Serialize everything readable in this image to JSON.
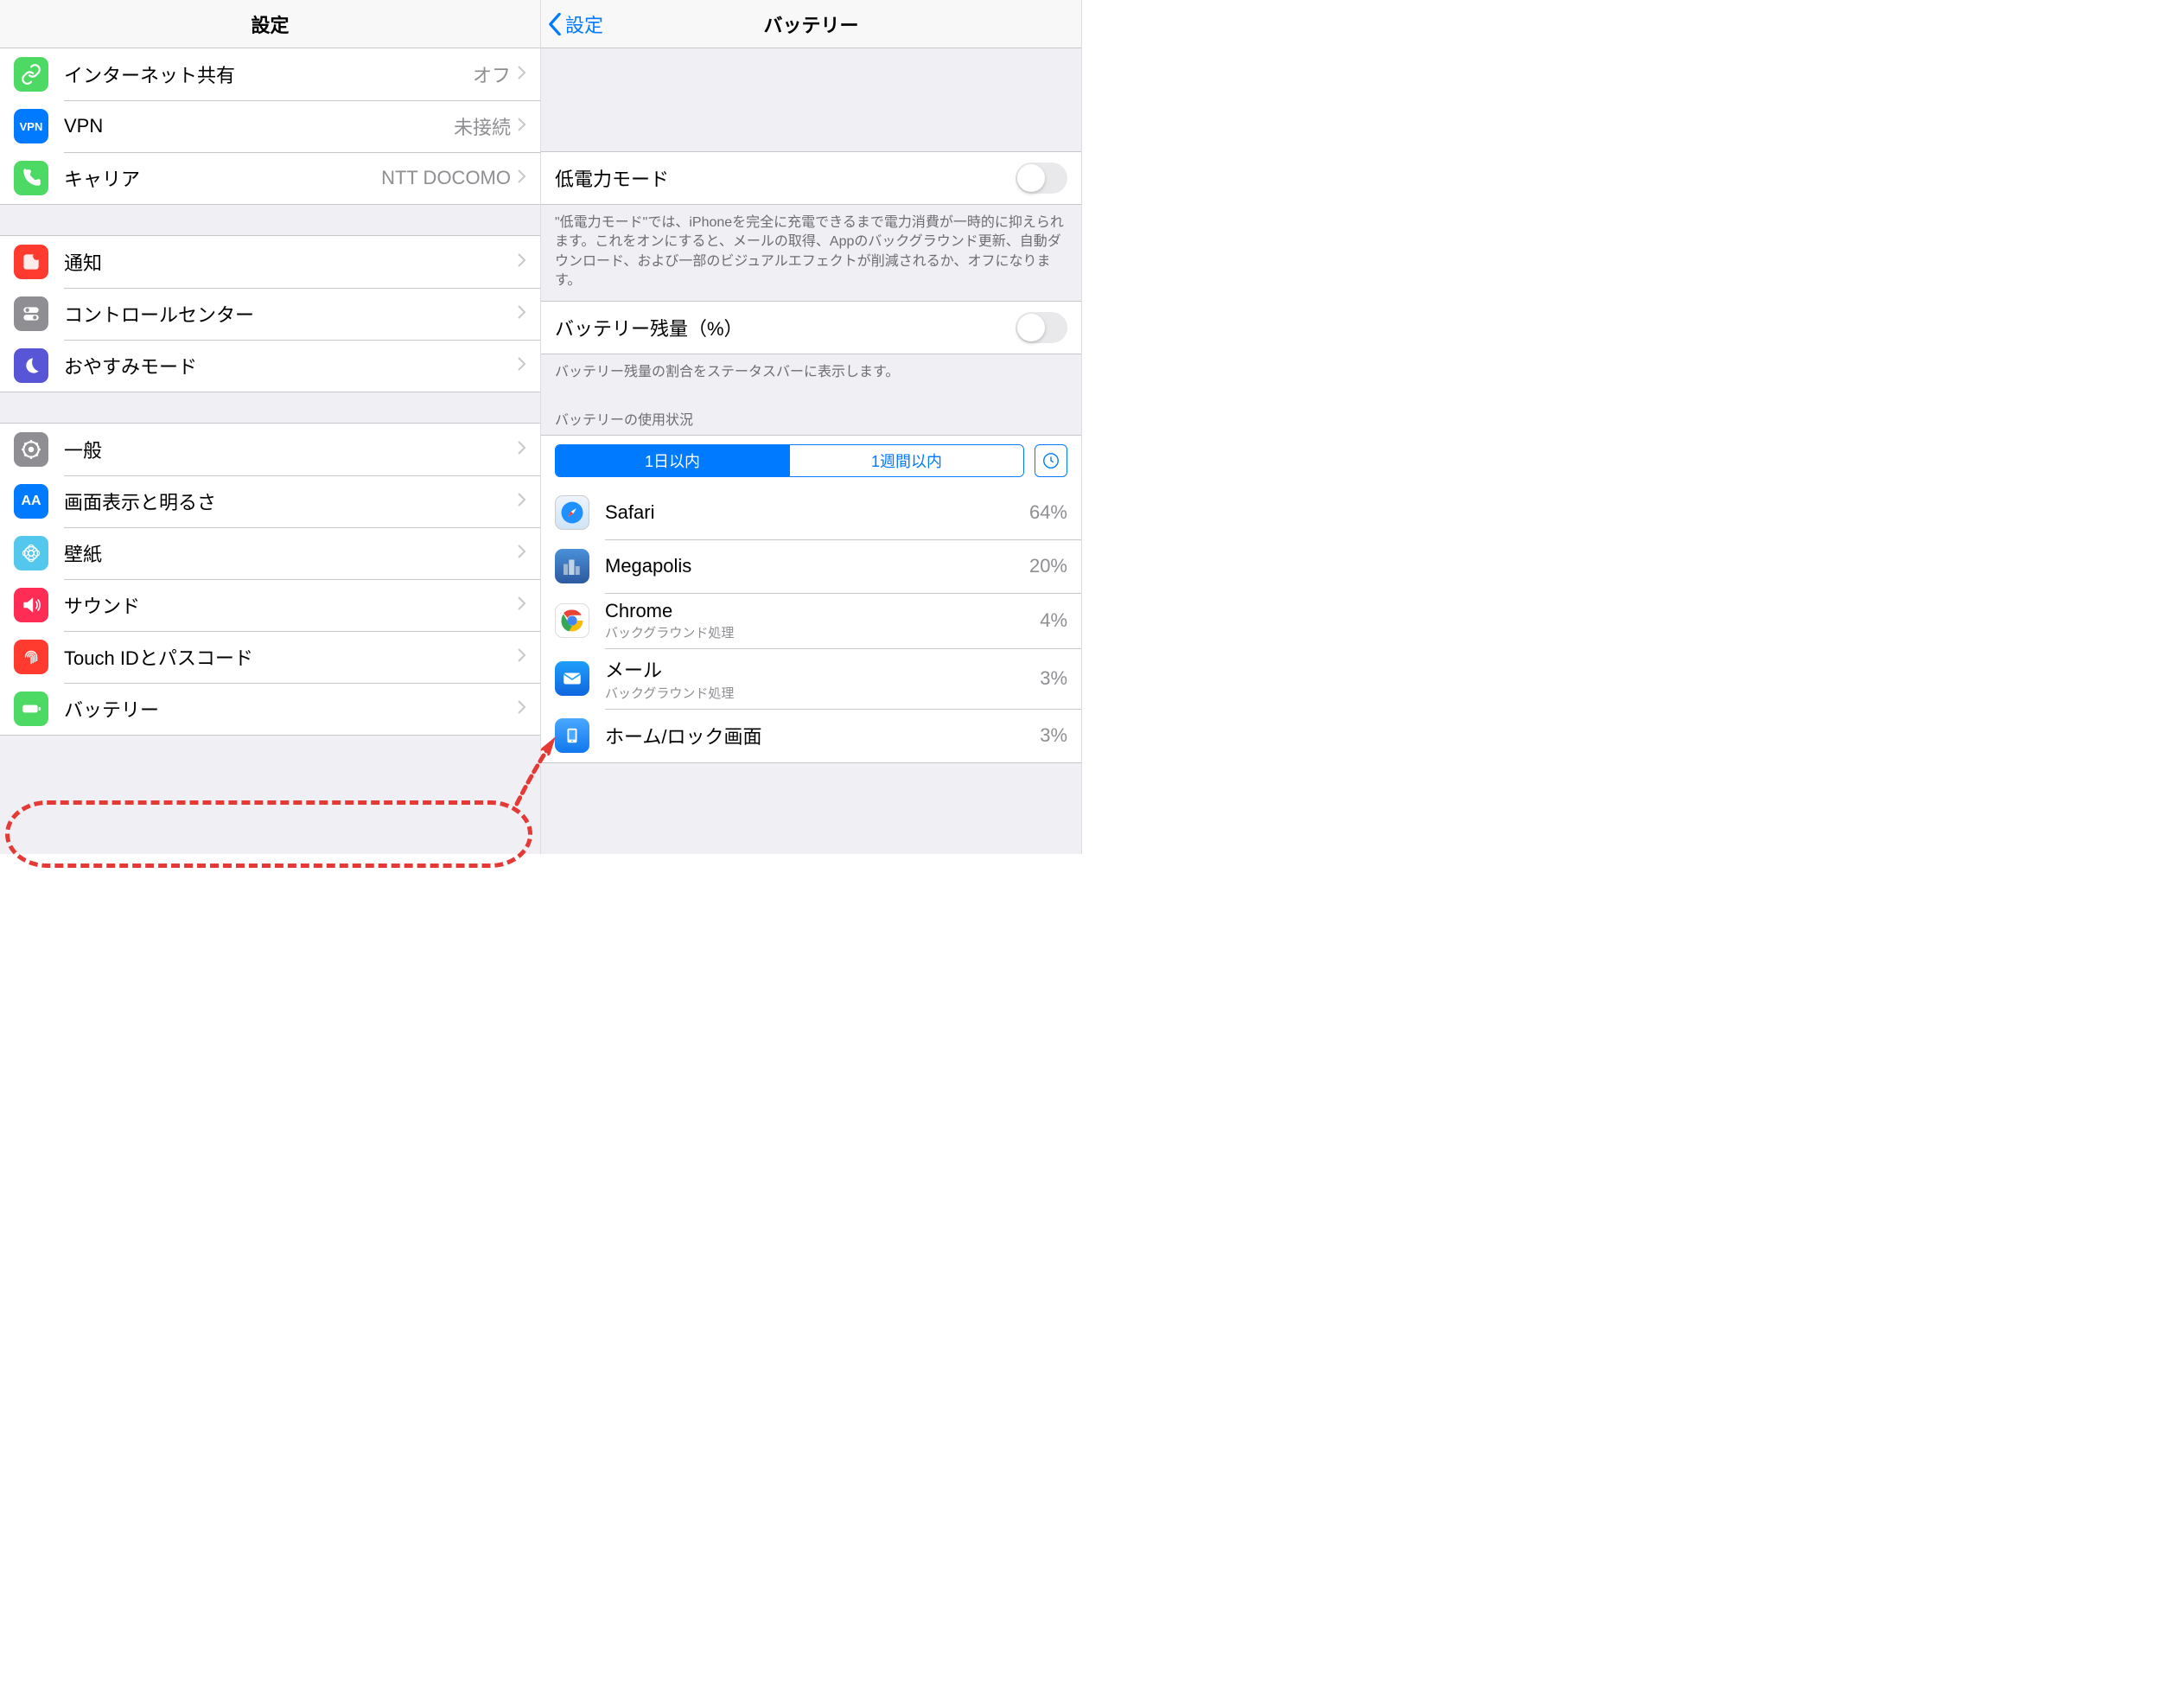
{
  "left": {
    "title": "設定",
    "groups": [
      {
        "rows": [
          {
            "icon": "link-icon",
            "bg": "#4cd964",
            "label": "インターネット共有",
            "value": "オフ"
          },
          {
            "icon": "vpn-icon",
            "bg": "#007aff",
            "label": "VPN",
            "value": "未接続",
            "iconText": "VPN"
          },
          {
            "icon": "phone-icon",
            "bg": "#4cd964",
            "label": "キャリア",
            "value": "NTT DOCOMO"
          }
        ]
      },
      {
        "rows": [
          {
            "icon": "notifications-icon",
            "bg": "#ff3b30",
            "label": "通知"
          },
          {
            "icon": "control-center-icon",
            "bg": "#8e8e93",
            "label": "コントロールセンター"
          },
          {
            "icon": "moon-icon",
            "bg": "#5856d6",
            "label": "おやすみモード"
          }
        ]
      },
      {
        "rows": [
          {
            "icon": "gear-icon",
            "bg": "#8e8e93",
            "label": "一般"
          },
          {
            "icon": "display-icon",
            "bg": "#007aff",
            "label": "画面表示と明るさ",
            "iconText": "AA"
          },
          {
            "icon": "wallpaper-icon",
            "bg": "#54c7ec",
            "label": "壁紙"
          },
          {
            "icon": "sound-icon",
            "bg": "#ff2d55",
            "label": "サウンド"
          },
          {
            "icon": "fingerprint-icon",
            "bg": "#ff3b30",
            "label": "Touch IDとパスコード"
          },
          {
            "icon": "battery-icon",
            "bg": "#4cd964",
            "label": "バッテリー"
          }
        ]
      }
    ]
  },
  "right": {
    "back": "設定",
    "title": "バッテリー",
    "lowPowerLabel": "低電力モード",
    "lowPowerFooter": "\"低電力モード\"では、iPhoneを完全に充電できるまで電力消費が一時的に抑えられます。これをオンにすると、メールの取得、Appのバックグラウンド更新、自動ダウンロード、および一部のビジュアルエフェクトが削減されるか、オフになります。",
    "pctLabel": "バッテリー残量（%）",
    "pctFooter": "バッテリー残量の割合をステータスバーに表示します。",
    "usageHeader": "バッテリーの使用状況",
    "seg1": "1日以内",
    "seg2": "1週間以内",
    "usage": [
      {
        "name": "Safari",
        "pct": "64%",
        "icon": "safari-icon"
      },
      {
        "name": "Megapolis",
        "pct": "20%",
        "icon": "game-icon"
      },
      {
        "name": "Chrome",
        "sub": "バックグラウンド処理",
        "pct": "4%",
        "icon": "chrome-icon"
      },
      {
        "name": "メール",
        "sub": "バックグラウンド処理",
        "pct": "3%",
        "icon": "mail-icon"
      },
      {
        "name": "ホーム/ロック画面",
        "pct": "3%",
        "icon": "home-icon"
      }
    ]
  }
}
